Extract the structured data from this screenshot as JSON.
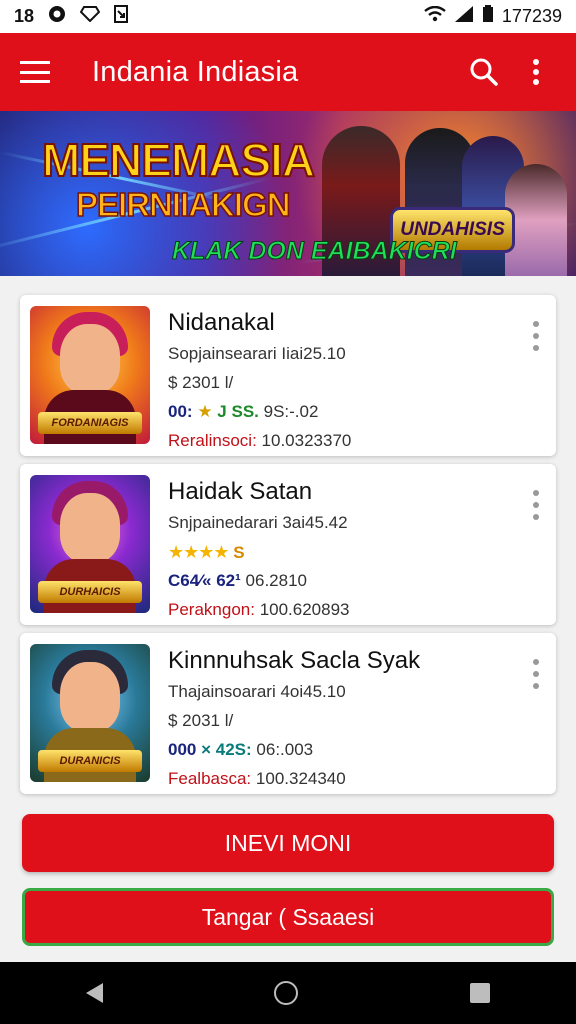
{
  "status_bar": {
    "left_text": "18",
    "time": "177239"
  },
  "app_bar": {
    "title": "Indania Indiasia",
    "menu_icon": "menu-icon",
    "search_icon": "search-icon",
    "more_icon": "more-vert-icon",
    "color": "#e0101a"
  },
  "banner": {
    "headline": "MENEMASIA",
    "subheadline": "PEIRNIIAKIGN",
    "cta": "KLAK DON EAIBAKICRI",
    "badge": "UNDAHISIS"
  },
  "items": [
    {
      "name": "Nidanakal",
      "subtitle": "Sopjainsearari Iiai25.10",
      "price": "$ 2301 l/",
      "stat_a": "00:",
      "stat_b": "J SS.",
      "stat_c": "9S:-.02",
      "footer_label": "Reralinsoci:",
      "footer_value": "10.0323370",
      "thumb_logo": "FORDANIAGIS"
    },
    {
      "name": "Haidak Satan",
      "subtitle": "Snjpainedarari 3ai45.42",
      "rating": "★★★★",
      "rating_suffix": "S",
      "stat_a": "C64⁄«",
      "stat_b": "62¹",
      "stat_c": "06.2810",
      "footer_label": "Perakngon:",
      "footer_value": "100.620893",
      "thumb_logo": "DURHAICIS"
    },
    {
      "name": "Kinnnuhsak Sacla Syak",
      "subtitle": "Thajainsoarari 4oi45.10",
      "price": "$ 2031 l/",
      "stat_a": "000",
      "stat_b": "× 42S:",
      "stat_c": "06:.003",
      "footer_label": "Fealbasca:",
      "footer_value": "100.324340",
      "thumb_logo": "DURANICIS"
    }
  ],
  "buttons": {
    "primary": "INEVI MONI",
    "secondary": "Tangar ( Ssaaesi"
  },
  "nav": {
    "back_icon": "back-icon",
    "home_icon": "home-icon",
    "recents_icon": "recents-icon"
  }
}
